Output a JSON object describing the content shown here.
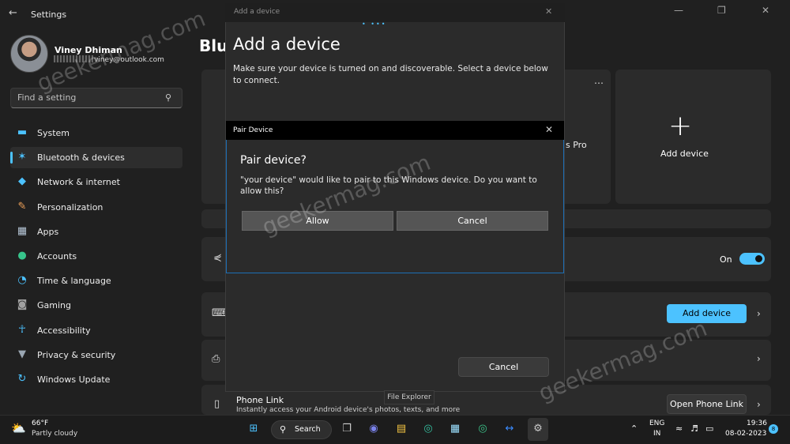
{
  "window": {
    "title": "Settings"
  },
  "profile": {
    "name": "Viney Dhiman",
    "email_suffix": "viney@outlook.com"
  },
  "search": {
    "placeholder": "Find a setting"
  },
  "sidebar": {
    "items": [
      {
        "label": "System",
        "icon": "monitor-icon",
        "color": "#4cc2ff"
      },
      {
        "label": "Bluetooth & devices",
        "icon": "bluetooth-icon",
        "color": "#4cc2ff",
        "active": true
      },
      {
        "label": "Network & internet",
        "icon": "wifi-icon",
        "color": "#4cc2ff"
      },
      {
        "label": "Personalization",
        "icon": "brush-icon",
        "color": "#f0a25a"
      },
      {
        "label": "Apps",
        "icon": "apps-grid-icon",
        "color": "#b7c7d8"
      },
      {
        "label": "Accounts",
        "icon": "person-icon",
        "color": "#37c48b"
      },
      {
        "label": "Time & language",
        "icon": "globe-clock-icon",
        "color": "#4cc2ff"
      },
      {
        "label": "Gaming",
        "icon": "gamepad-icon",
        "color": "#a0a0a0"
      },
      {
        "label": "Accessibility",
        "icon": "accessibility-icon",
        "color": "#4cc2ff"
      },
      {
        "label": "Privacy & security",
        "icon": "shield-icon",
        "color": "#9aa6b2"
      },
      {
        "label": "Windows Update",
        "icon": "refresh-icon",
        "color": "#4cc2ff"
      }
    ]
  },
  "main": {
    "page_title_peek": "Blue",
    "card_peek_text": "s Pro",
    "add_device_card_label": "Add device",
    "bluetooth_toggle_label": "On",
    "bluetooth_toggle_on": true,
    "add_device_button": "Add device",
    "phone_link": {
      "title": "Phone Link",
      "subtitle": "Instantly access your Android device's photos, texts, and more",
      "button": "Open Phone Link"
    }
  },
  "add_dialog": {
    "titlebar": "Add a device",
    "heading": "Add a device",
    "description": "Make sure your device is turned on and discoverable. Select a device below to connect.",
    "cancel": "Cancel"
  },
  "pair_dialog": {
    "titlebar": "Pair Device",
    "heading": "Pair device?",
    "message": "\"your device\" would like to pair to this Windows device. Do you want to allow this?",
    "allow": "Allow",
    "cancel": "Cancel"
  },
  "tooltip": "File Explorer",
  "watermark": "geekermag.com",
  "taskbar": {
    "weather_temp": "66°F",
    "weather_condition": "Partly cloudy",
    "search_label": "Search",
    "lang_top": "ENG",
    "lang_bottom": "IN",
    "time": "19:36",
    "date": "08-02-2023",
    "notification_count": "8"
  },
  "colors": {
    "accent": "#4cc2ff",
    "dialog_border": "#1d6fb6"
  }
}
